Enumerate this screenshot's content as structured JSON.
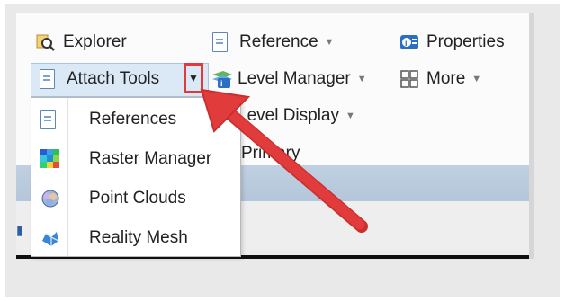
{
  "ribbon": {
    "explorer_label": "Explorer",
    "reference_label": "Reference",
    "properties_label": "Properties",
    "attach_tools_label": "Attach Tools",
    "level_manager_label": "Level Manager",
    "more_label": "More",
    "level_display_label": "Level Display",
    "primary_label": "Primary"
  },
  "dropdown_items": [
    {
      "label": "References",
      "icon": "document-icon"
    },
    {
      "label": "Raster Manager",
      "icon": "raster-grid-icon"
    },
    {
      "label": "Point Clouds",
      "icon": "point-cloud-icon"
    },
    {
      "label": "Reality Mesh",
      "icon": "reality-mesh-icon"
    }
  ],
  "annotation": {
    "highlight_color": "#e03a3a",
    "arrow_color": "#e23b3b"
  }
}
